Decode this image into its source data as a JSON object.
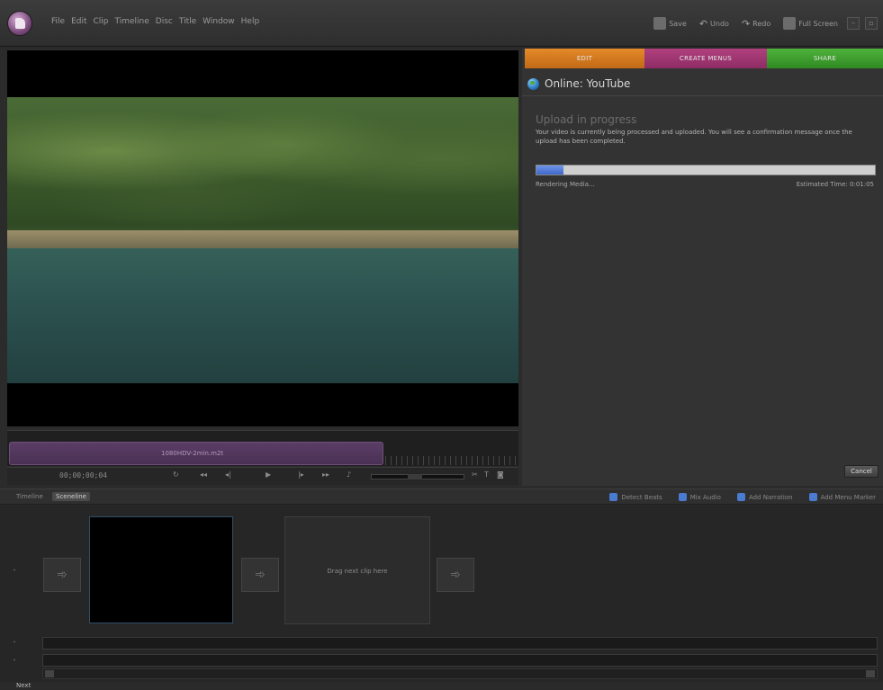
{
  "menu": [
    "File",
    "Edit",
    "Clip",
    "Timeline",
    "Disc",
    "Title",
    "Window",
    "Help"
  ],
  "toolbar": {
    "save": "Save",
    "undo": "Undo",
    "redo": "Redo",
    "fullscreen": "Full Screen"
  },
  "preview": {
    "clip_name": "1080HDV-2min.m2t",
    "timecode": "00;00;00;04"
  },
  "panel": {
    "tabs": {
      "edit": "EDIT",
      "create_menus": "CREATE MENUS",
      "share": "SHARE"
    },
    "heading": "Online: YouTube",
    "upload_title": "Upload in progress",
    "upload_desc": "Your video is currently being processed and uploaded. You will see a confirmation message once the upload has been completed.",
    "progress_fraction": 0.08,
    "status_left": "Rendering Media...",
    "status_right": "Estimated Time: 0:01:05",
    "cancel": "Cancel"
  },
  "bottom": {
    "tabs": {
      "timeline": "Timeline",
      "sceneline": "Sceneline"
    },
    "actions": {
      "detect_beats": "Detect Beats",
      "mix_audio": "Mix Audio",
      "add_narration": "Add Narration",
      "add_menu_marker": "Add Menu Marker"
    },
    "drop_text": "Drag next clip here"
  },
  "footer": {
    "next": "Next"
  },
  "colors": {
    "edit_tab": "#e58a2a",
    "menus_tab": "#b0407e",
    "share_tab": "#4fb23c",
    "progress": "#3f67c7"
  }
}
